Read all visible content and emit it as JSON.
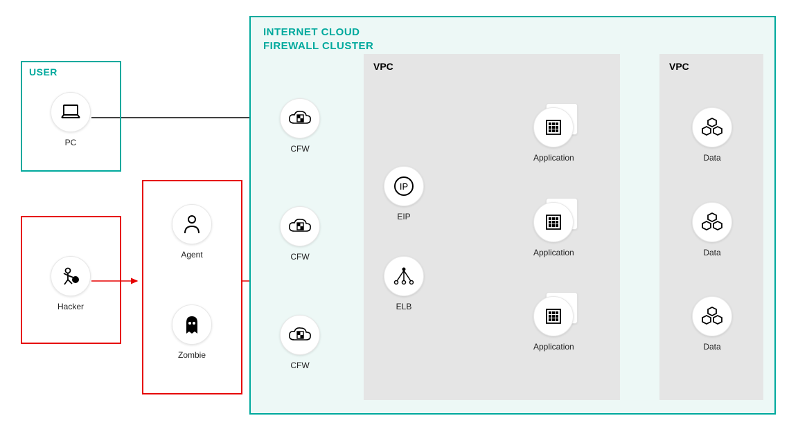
{
  "user_title": "USER",
  "cluster_title_line1": "INTERNET CLOUD",
  "cluster_title_line2": "FIREWALL CLUSTER",
  "vpc1_title": "VPC",
  "vpc2_title": "VPC",
  "nodes": {
    "pc": "PC",
    "hacker": "Hacker",
    "agent": "Agent",
    "zombie": "Zombie",
    "cfw": "CFW",
    "eip": "EIP",
    "elb": "ELB",
    "application": "Application",
    "data": "Data"
  },
  "colors": {
    "teal": "#00a99d",
    "red": "#e60000",
    "gray": "#e5e5e5",
    "mint": "#edf8f6"
  }
}
